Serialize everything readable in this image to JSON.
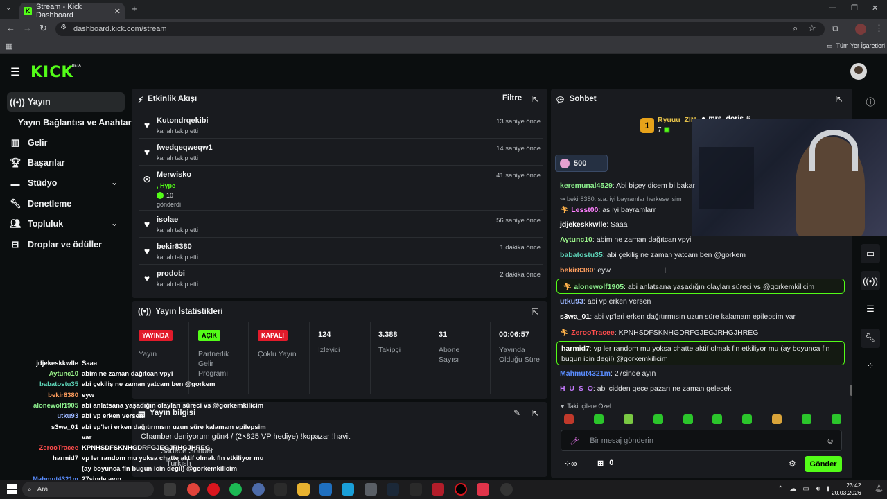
{
  "browser": {
    "tab_title": "Stream - Kick Dashboard",
    "url": "dashboard.kick.com/stream",
    "bookmarks_label": "Tüm Yer İşaretleri"
  },
  "header": {
    "logo": "KICK",
    "beta": "BETA"
  },
  "sidebar": {
    "items": [
      {
        "label": "Yayın",
        "icon": "broadcast-icon"
      },
      {
        "label": "Yayın Bağlantısı ve Anahtarı",
        "icon": ""
      },
      {
        "label": "Gelir",
        "icon": "columns-icon"
      },
      {
        "label": "Başarılar",
        "icon": "trophy-icon"
      },
      {
        "label": "Stüdyo",
        "icon": "studio-icon"
      },
      {
        "label": "Denetleme",
        "icon": "wrench-icon"
      },
      {
        "label": "Topluluk",
        "icon": "community-icon"
      },
      {
        "label": "Droplar ve ödüller",
        "icon": "drops-icon"
      }
    ]
  },
  "activity": {
    "title": "Etkinlik Akışı",
    "filter": "Filtre",
    "events": [
      {
        "user": "Kutondrqekibi",
        "action": "kanalı takip etti",
        "time": "13 saniye önce"
      },
      {
        "user": "fwedqeqweqw1",
        "action": "kanalı takip etti",
        "time": "14 saniye önce"
      },
      {
        "user": "Merwisko",
        "hype": ", Hype",
        "count": "10",
        "action": "gönderdi",
        "time": "41 saniye önce"
      },
      {
        "user": "isolae",
        "action": "kanalı takip etti",
        "time": "56 saniye önce"
      },
      {
        "user": "bekir8380",
        "action": "kanalı takip etti",
        "time": "1 dakika önce"
      },
      {
        "user": "prodobi",
        "action": "kanalı takip etti",
        "time": "2 dakika önce"
      }
    ]
  },
  "stats": {
    "title": "Yayın İstatistikleri",
    "items": [
      {
        "value": "YAYINDA",
        "label": "Yayın"
      },
      {
        "value": "AÇIK",
        "label": "Partnerlik Gelir Programı"
      },
      {
        "value": "KAPALI",
        "label": "Çoklu Yayın"
      },
      {
        "value": "124",
        "label": "İzleyici"
      },
      {
        "value": "3.388",
        "label": "Takipçi"
      },
      {
        "value": "31",
        "label": "Abone Sayısı"
      },
      {
        "value": "00:06:57",
        "label": "Yayında Olduğu Süre"
      }
    ],
    "colors": {
      "live": "#e21b2b",
      "on": "#53fc18",
      "off": "#e21b2b"
    }
  },
  "stream_info": {
    "title": "Yayın bilgisi",
    "stream_title": "Chamber deniyorum gün4 / (2×825 VP hediye) !kopazar !havit",
    "chat_mode": "Sadece Sohbet",
    "language": "Turkish"
  },
  "chat": {
    "title": "Sohbet",
    "pinned_user1": "Ryuuu_ZIN",
    "pinned_user2": "mrs_doris",
    "pinned_count1": "7",
    "pinned_count2": "6",
    "pinned_rank": "1",
    "gift_amount": "500",
    "reply_context": "bekir8380: s.a. iyi bayramlar herkese isim",
    "messages": [
      {
        "user": "keremunal4529",
        "text": "Abi bişey dicem bi bakar",
        "color": "#8ef08e"
      },
      {
        "user": "Lesst00",
        "text": "as iyi bayramlarr",
        "color": "#ff80ff"
      },
      {
        "user": "jdjekeskkwlle",
        "text": "Saaa",
        "color": "#ffffff"
      },
      {
        "user": "Aytunc10",
        "text": "abim ne zaman dağıtcan vpyi",
        "color": "#9cf58b"
      },
      {
        "user": "babatostu35",
        "text": "abi çekiliş ne zaman yatcam ben @gorkem",
        "color": "#5ed4b8"
      },
      {
        "user": "bekir8380",
        "text": "eyw",
        "color": "#ff9e5e"
      },
      {
        "user": "alonewolf1905",
        "text": "abi anlatsana yaşadığın olayları süreci vs @gorkemkilicim",
        "color": "#8ef08e"
      },
      {
        "user": "utku93",
        "text": "abi vp erken versen",
        "color": "#9bb6ff"
      },
      {
        "user": "s3wa_01",
        "text": "abi vp'leri erken dağıtırmısın uzun süre kalamam epilepsim var",
        "color": "#ffffff"
      },
      {
        "user": "ZeroοTracee",
        "text": "KPNHSDFSKNHGDRFGJEGJRHGJHREG",
        "color": "#ff4d4d"
      },
      {
        "user": "harmid7",
        "text": "vp ler random mu yoksa chatte aktif olmak fln etkiliyor mu (ay boyunca fln bugun icin degil) @gorkemkilicim",
        "color": "#ffffff"
      },
      {
        "user": "Mahmut4321m",
        "text": "27sinde ayın",
        "color": "#5a8dff"
      },
      {
        "user": "H_U_S_O",
        "text": "abi cidden gece pazarı ne zaman gelecek",
        "color": "#c67bff"
      }
    ],
    "followers_only": "Takipçilere Özel",
    "input_placeholder": "Bir mesaj gönderin",
    "points": "0",
    "send": "Gönder"
  },
  "overlay_chat": [
    {
      "user": "jdjekeskkwlle",
      "text": "Saaa",
      "color": "#ffffff"
    },
    {
      "user": "Aytunc10",
      "text": "abim ne zaman dağıtcan vpyi",
      "color": "#9cf58b"
    },
    {
      "user": "babatostu35",
      "text": "abi çekiliş ne zaman yatcam ben @gorkem",
      "color": "#5ed4b8"
    },
    {
      "user": "bekir8380",
      "text": "eyw",
      "color": "#ff9e5e"
    },
    {
      "user": "alonewolf1905",
      "text": "abi anlatsana yaşadığın olayları süreci vs @gorkemkilicim",
      "color": "#8ef08e"
    },
    {
      "user": "utku93",
      "text": "abi vp erken versen",
      "color": "#9bb6ff"
    },
    {
      "user": "s3wa_01",
      "text": "abi vp'leri erken dağıtırmısın uzun süre kalamam epilepsim",
      "color": "#ffffff"
    },
    {
      "user": "",
      "text": "var",
      "color": "#ffffff"
    },
    {
      "user": "ZeroοTracee",
      "text": "KPNHSDFSKNHGDRFGJEGJRHGJHREG",
      "color": "#ff4d4d"
    },
    {
      "user": "harmid7",
      "text": "vp ler random mu yoksa chatte aktif olmak fln etkiliyor mu",
      "color": "#ffffff"
    },
    {
      "user": "",
      "text": "(ay boyunca fln bugun icin degil) @gorkemkilicim",
      "color": "#ffffff"
    },
    {
      "user": "Mahmut4321m",
      "text": "27sinde ayın",
      "color": "#5a8dff"
    }
  ],
  "taskbar": {
    "search": "Ara",
    "time": "23:42",
    "date": "20.03.2026"
  }
}
